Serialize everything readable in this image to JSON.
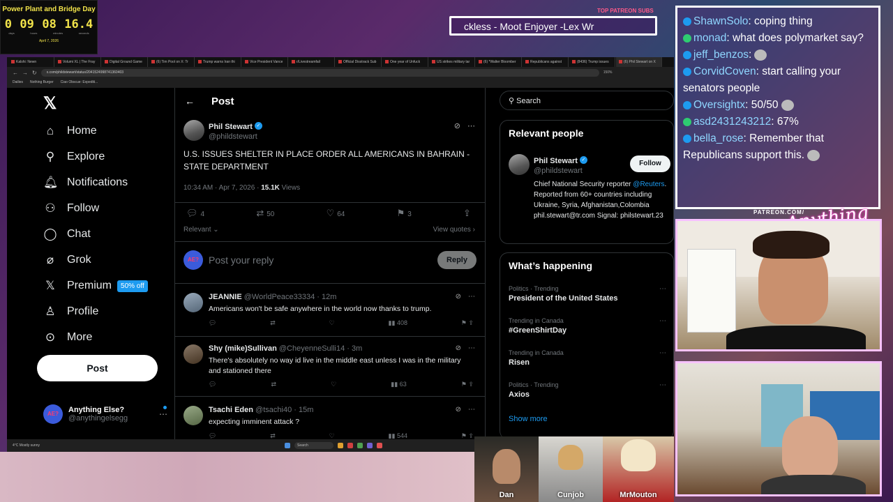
{
  "timer": {
    "title": "Power Plant and Bridge Day",
    "digits": [
      "0",
      "09",
      "08",
      "16.4"
    ],
    "units": [
      "days",
      "hours",
      "minutes",
      "seconds"
    ],
    "date": "April 7, 2026"
  },
  "patreon": {
    "heading": "TOP PATREON SUBS",
    "ticker": "ckless - Moot Enjoyer -Lex Wr",
    "footer": "PATREON.COM/",
    "brand": "Anything Else?"
  },
  "browser": {
    "tabs": [
      "Kalshi: Newn",
      "Volumi XL | The Fray",
      "Digital Ground Game",
      "(6) Tim Pool on X: Tr",
      "Trump warns Iran thi",
      "Vice President Vance",
      "r/Livestreamfail",
      "Official Disstrack Sub",
      "One year of Unfuck",
      "US strikes military tar",
      "(6) *Walter Bloomber",
      "Republicans against",
      "(8436) Trump issues",
      "(6) Phil Stewart on X"
    ],
    "url": "x.com/phildstewart/status/2041524998741360403",
    "zoom": "150%",
    "bookmarks": [
      "Dailies",
      "Nothing Burger",
      "Ciao Obscue: Expediti..."
    ]
  },
  "nav": {
    "items": [
      {
        "label": "Home",
        "icon": "home-icon"
      },
      {
        "label": "Explore",
        "icon": "search-icon"
      },
      {
        "label": "Notifications",
        "icon": "bell-icon"
      },
      {
        "label": "Follow",
        "icon": "add-person-icon"
      },
      {
        "label": "Chat",
        "icon": "chat-icon"
      },
      {
        "label": "Grok",
        "icon": "grok-icon"
      },
      {
        "label": "Premium",
        "icon": "x-icon"
      },
      {
        "label": "Profile",
        "icon": "person-icon"
      },
      {
        "label": "More",
        "icon": "more-circle-icon"
      }
    ],
    "premium_badge": "50% off",
    "post_button": "Post"
  },
  "account": {
    "name": "Anything Else?",
    "handle": "@anythingelsegg",
    "avatar_text": "AE?"
  },
  "post": {
    "header": "Post",
    "author": "Phil Stewart",
    "handle": "@phildstewart",
    "text": "U.S. ISSUES SHELTER IN PLACE ORDER ALL AMERICANS IN BAHRAIN - STATE DEPARTMENT",
    "time": "10:34 AM · Apr 7, 2026 ·",
    "views_count": "15.1K",
    "views_label": "Views",
    "replies": "4",
    "reposts": "50",
    "likes": "64",
    "bookmarks": "3",
    "sort": "Relevant",
    "view_quotes": "View quotes"
  },
  "reply_box": {
    "placeholder": "Post your reply",
    "button": "Reply"
  },
  "replies": [
    {
      "name": "JEANNIE",
      "handle": "@WorldPeace33334 · 12m",
      "text": "Americans won't be safe anywhere in the world now thanks to trump.",
      "views": "408"
    },
    {
      "name": "Shy (mike)Sullivan",
      "handle": "@CheyenneSulli14 · 3m",
      "text": "There's absolutely no way id live in the middle east unless I was in the military and stationed there",
      "views": "63"
    },
    {
      "name": "Tsachi Eden",
      "handle": "@tsachi40 · 15m",
      "text": "expecting imminent attack ?",
      "views": "544"
    }
  ],
  "right": {
    "search_placeholder": "Search",
    "relevant_title": "Relevant people",
    "person": {
      "name": "Phil Stewart",
      "handle": "@phildstewart",
      "follow": "Follow",
      "bio_pre": "Chief National Security reporter",
      "bio_link": "@Reuters",
      "bio_post": ". Reported from 60+ countries including Ukraine, Syria, Afghanistan,Colombia phil.stewart@tr.com Signal: philstewart.23"
    },
    "happening_title": "What’s happening",
    "trends": [
      {
        "context": "Politics · Trending",
        "title": "President of the United States"
      },
      {
        "context": "Trending in Canada",
        "title": "#GreenShirtDay"
      },
      {
        "context": "Trending in Canada",
        "title": "Risen"
      },
      {
        "context": "Politics · Trending",
        "title": "Axios"
      }
    ],
    "show_more": "Show more"
  },
  "taskbar": {
    "weather": "Mostly sunny",
    "temp": "4°C",
    "search": "Search"
  },
  "chat": [
    {
      "user": "ShawnSolo",
      "text": ": coping thing"
    },
    {
      "user": "monad",
      "text": ": what does polymarket say?"
    },
    {
      "user": "jeff_benzos",
      "text": ":"
    },
    {
      "user": "CorvidCoven",
      "text": ": start calling your senators people"
    },
    {
      "user": "Oversightx",
      "text": ": 50/50"
    },
    {
      "user": "asd2431243212",
      "text": ": 67%"
    },
    {
      "user": "bella_rose",
      "text": ": Remember that Republicans support this."
    }
  ],
  "bottom_cams": [
    "Dan",
    "Cunjob",
    "MrMouton"
  ]
}
